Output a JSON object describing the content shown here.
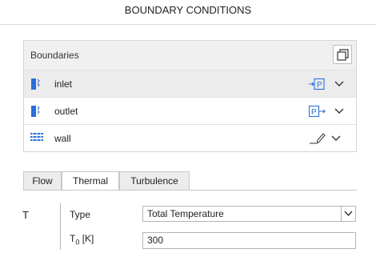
{
  "header": {
    "title": "BOUNDARY CONDITIONS"
  },
  "boundaries": {
    "title": "Boundaries",
    "copy_icon": "copy-icon",
    "items": [
      {
        "label": "inlet",
        "icon": "inlet-boundary-icon",
        "action_icon": "pressure-inlet-icon",
        "selected": true
      },
      {
        "label": "outlet",
        "icon": "outlet-boundary-icon",
        "action_icon": "pressure-outlet-icon",
        "selected": false
      },
      {
        "label": "wall",
        "icon": "wall-boundary-icon",
        "action_icon": "edit-icon",
        "selected": false
      }
    ]
  },
  "tabs": [
    {
      "label": "Flow",
      "active": false
    },
    {
      "label": "Thermal",
      "active": true
    },
    {
      "label": "Turbulence",
      "active": false
    }
  ],
  "thermal": {
    "symbol": "T",
    "type_label": "Type",
    "type_value": "Total Temperature",
    "t0_label_main": "T",
    "t0_label_sub": "0",
    "t0_label_unit": " [K]",
    "t0_value": "300"
  },
  "colors": {
    "accent": "#2a6fd6",
    "panel_header": "#f0f0f0",
    "selected_row": "#ececec"
  }
}
